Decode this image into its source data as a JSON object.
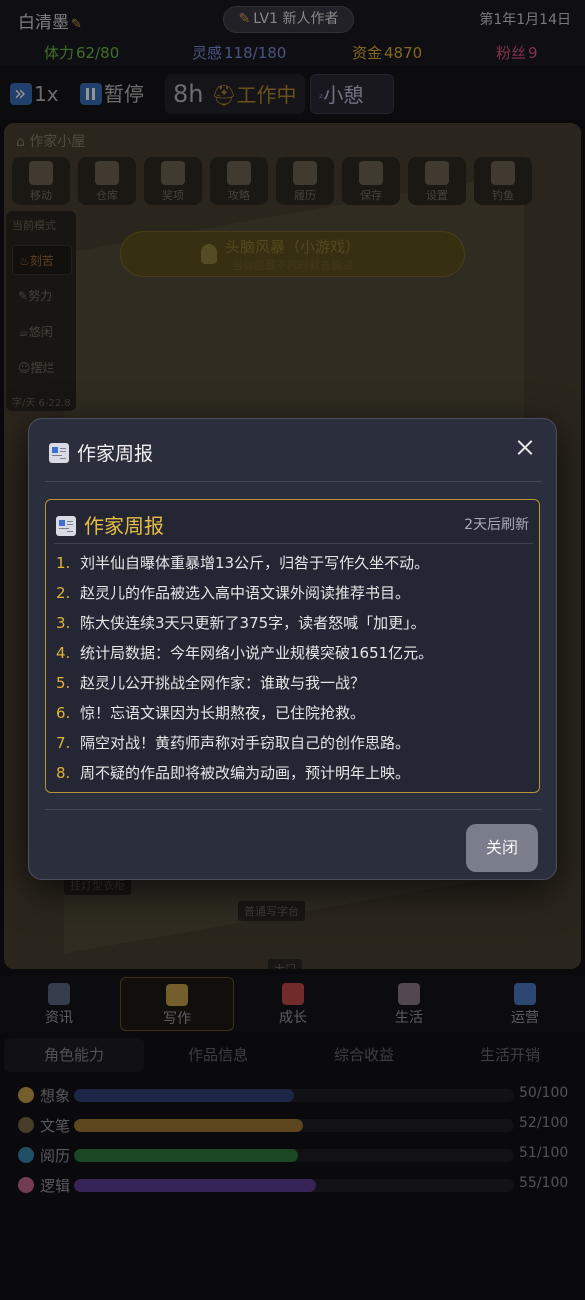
{
  "player": {
    "name": "白清墨",
    "level": "LV1 新人作者",
    "date": "第1年1月14日"
  },
  "stats": [
    {
      "label": "体力",
      "value": "62/80",
      "color": "#6fbf4e"
    },
    {
      "label": "灵感",
      "value": "118/180",
      "color": "#7f8fe0"
    },
    {
      "label": "资金",
      "value": "4870",
      "color": "#e0b23a"
    },
    {
      "label": "粉丝",
      "value": "9",
      "color": "#e0577f"
    }
  ],
  "speed": {
    "speed_label": "1x",
    "pause_label": "暂停",
    "hours": "8h",
    "status": "工作中",
    "rest_label": "小憩"
  },
  "room": {
    "title": "作家小屋",
    "tools": [
      "移动",
      "仓库",
      "奖项",
      "攻略",
      "履历",
      "保存",
      "设置",
      "钓鱼"
    ],
    "mode_title": "当前模式",
    "modes": [
      "刻苦",
      "努力",
      "悠闲",
      "摆烂"
    ],
    "mode_footer": "字/天 6-22.8",
    "brain_title": "头脑风暴（小游戏）",
    "brain_sub": "当你瓶颈不再时就去尝试",
    "label_stand": "挂灯型衣柜",
    "label_desk": "普通写字台",
    "label_door": "大门"
  },
  "modal": {
    "title": "作家周报",
    "box_title": "作家周报",
    "refresh": "2天后刷新",
    "items": [
      "刘半仙自曝体重暴增13公斤，归咎于写作久坐不动。",
      "赵灵儿的作品被选入高中语文课外阅读推荐书目。",
      "陈大侠连续3天只更新了375字，读者怒喊「加更」。",
      "统计局数据：今年网络小说产业规模突破1651亿元。",
      "赵灵儿公开挑战全网作家：谁敢与我一战？",
      "惊！忘语文课因为长期熬夜，已住院抢救。",
      "隔空对战！黄药师声称对手窃取自己的创作思路。",
      "周不疑的作品即将被改编为动画，预计明年上映。"
    ],
    "item_numbers": [
      "1.",
      "2.",
      "3.",
      "4.",
      "5.",
      "6.",
      "7.",
      "8."
    ],
    "close_label": "关闭"
  },
  "bottom_nav": {
    "items": [
      {
        "label": "资讯",
        "icon": "news-icon",
        "color": "#5c6a86"
      },
      {
        "label": "写作",
        "icon": "pen-icon",
        "color": "#c9a24c"
      },
      {
        "label": "成长",
        "icon": "growth-chart-icon",
        "color": "#c44a4a"
      },
      {
        "label": "生活",
        "icon": "house-icon",
        "color": "#8a7a8a"
      },
      {
        "label": "运营",
        "icon": "megaphone-icon",
        "color": "#4a7ac4"
      }
    ],
    "active_index": 1
  },
  "tabs": {
    "items": [
      "角色能力",
      "作品信息",
      "综合收益",
      "生活开销"
    ],
    "active_index": 0
  },
  "abilities": [
    {
      "label": "想象",
      "value": "50/100",
      "fraction": 0.5,
      "color": "#34437a",
      "icon": "bulb-icon",
      "icon_color": "#c9a24c"
    },
    {
      "label": "文笔",
      "value": "52/100",
      "fraction": 0.52,
      "color": "#a27a34",
      "icon": "pen-icon",
      "icon_color": "#7a6a4a"
    },
    {
      "label": "阅历",
      "value": "51/100",
      "fraction": 0.51,
      "color": "#2f7a3e",
      "icon": "globe-icon",
      "icon_color": "#3a8ab0"
    },
    {
      "label": "逻辑",
      "value": "55/100",
      "fraction": 0.55,
      "color": "#5d3f94",
      "icon": "brain-icon",
      "icon_color": "#c46a8a"
    }
  ]
}
